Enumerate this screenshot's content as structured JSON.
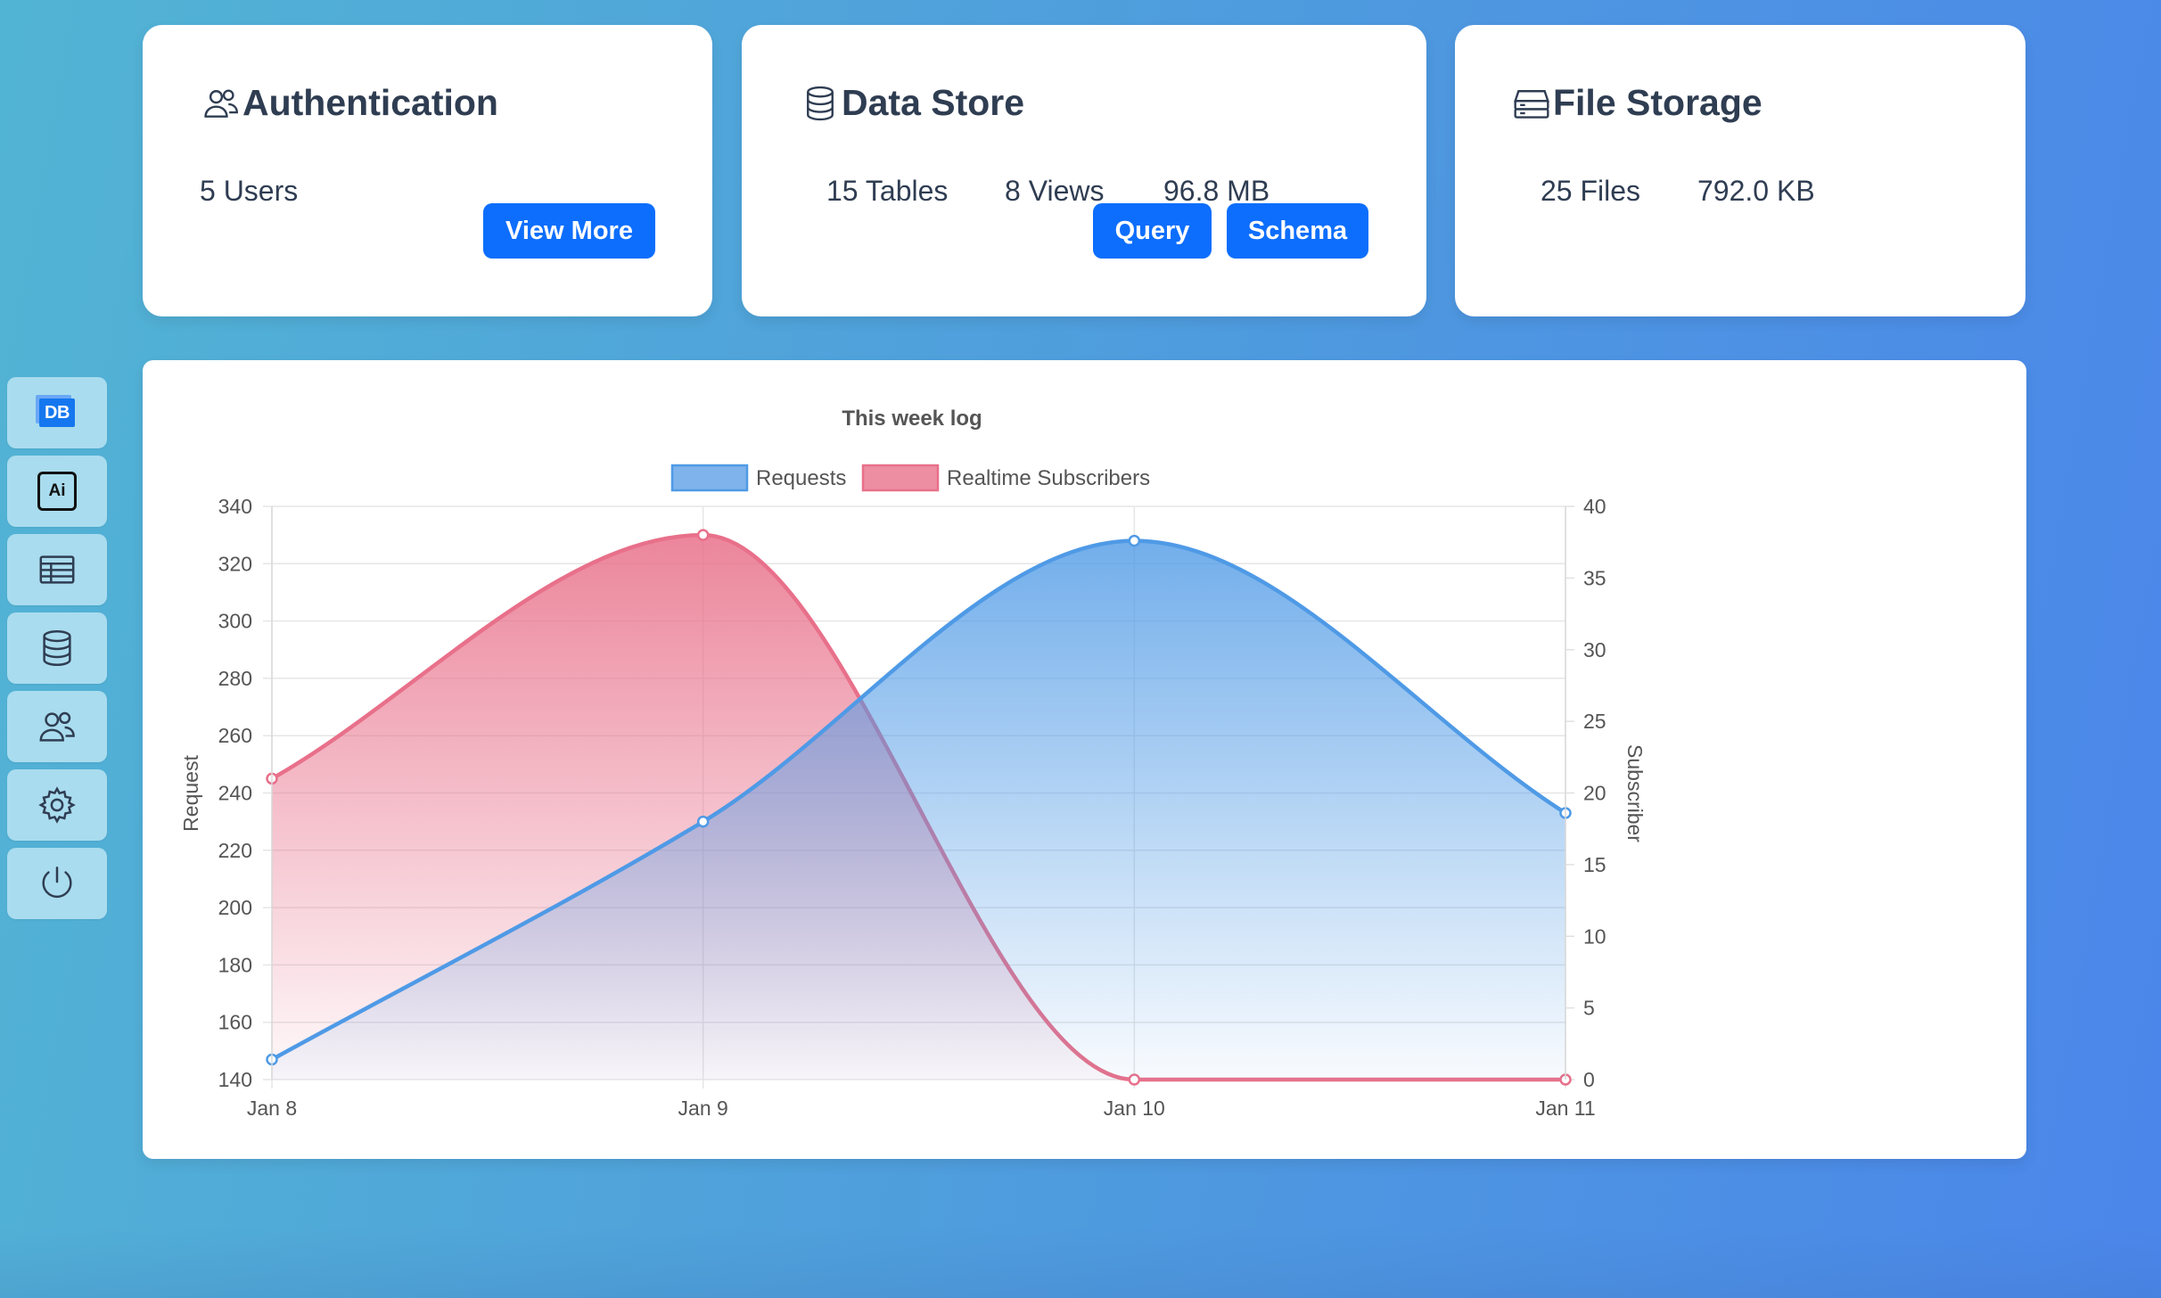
{
  "sidebar": {
    "items": [
      {
        "name": "db",
        "icon": "db-logo-icon",
        "label": "DB"
      },
      {
        "name": "ai",
        "icon": "ai-icon",
        "label": "Ai"
      },
      {
        "name": "tables",
        "icon": "table-icon"
      },
      {
        "name": "database",
        "icon": "database-icon"
      },
      {
        "name": "users",
        "icon": "users-icon"
      },
      {
        "name": "settings",
        "icon": "gear-icon"
      },
      {
        "name": "power",
        "icon": "power-icon"
      }
    ]
  },
  "cards": {
    "auth": {
      "title": "Authentication",
      "icon": "users-icon",
      "users": "5 Users",
      "button": "View More"
    },
    "datastore": {
      "title": "Data Store",
      "icon": "database-icon",
      "tables": "15 Tables",
      "views": "8 Views",
      "size": "96.8 MB",
      "query_button": "Query",
      "schema_button": "Schema"
    },
    "files": {
      "title": "File Storage",
      "icon": "storage-icon",
      "files": "25 Files",
      "size": "792.0 KB"
    }
  },
  "colors": {
    "accent": "#0d6efd",
    "requests": "#4f9ae6",
    "subscribers": "#e8708a",
    "sidebar_btn": "#a9dcee"
  },
  "chart_data": {
    "type": "area",
    "title": "This week log",
    "categories": [
      "Jan 8",
      "Jan 9",
      "Jan 10",
      "Jan 11"
    ],
    "legend": [
      "Requests",
      "Realtime Subscribers"
    ],
    "legend_position": "top",
    "grid": true,
    "y_left": {
      "label": "Request",
      "ticks": [
        140,
        160,
        180,
        200,
        220,
        240,
        260,
        280,
        300,
        320,
        340
      ],
      "range": [
        140,
        340
      ]
    },
    "y_right": {
      "label": "Subscriber",
      "ticks": [
        0,
        5,
        10,
        15,
        20,
        25,
        30,
        35,
        40
      ],
      "range": [
        0,
        40
      ]
    },
    "series": [
      {
        "name": "Requests",
        "axis": "left",
        "values": [
          147,
          230,
          328,
          233
        ],
        "color": "#4f9ae6"
      },
      {
        "name": "Realtime Subscribers",
        "axis": "right",
        "values": [
          21,
          38,
          0,
          0
        ],
        "color": "#e8708a"
      }
    ]
  }
}
